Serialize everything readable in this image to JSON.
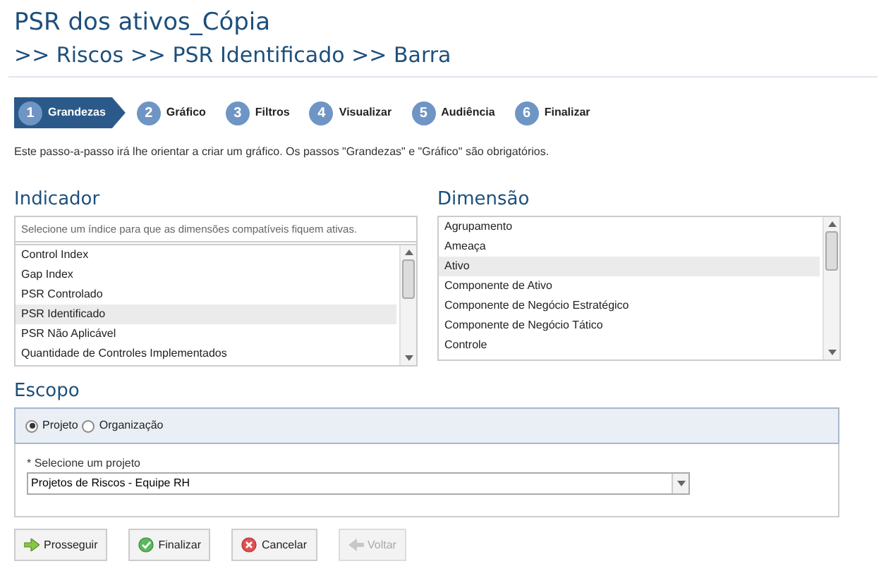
{
  "title": "PSR dos ativos_Cópia",
  "breadcrumb": ">> Riscos >> PSR Identificado >> Barra",
  "steps": [
    {
      "number": "1",
      "label": "Grandezas",
      "selected": true
    },
    {
      "number": "2",
      "label": "Gráfico",
      "selected": false
    },
    {
      "number": "3",
      "label": "Filtros",
      "selected": false
    },
    {
      "number": "4",
      "label": "Visualizar",
      "selected": false
    },
    {
      "number": "5",
      "label": "Audiência",
      "selected": false
    },
    {
      "number": "6",
      "label": "Finalizar",
      "selected": false
    }
  ],
  "intro": "Este passo-a-passo irá lhe orientar a criar um gráfico. Os passos \"Grandezas\" e \"Gráfico\" são obrigatórios.",
  "indicador": {
    "heading": "Indicador",
    "hint": "Selecione um índice para que as dimensões compatíveis fiquem ativas.",
    "items": [
      {
        "label": "Control Index",
        "selected": false
      },
      {
        "label": "Gap Index",
        "selected": false
      },
      {
        "label": "PSR Controlado",
        "selected": false
      },
      {
        "label": "PSR Identificado",
        "selected": true
      },
      {
        "label": "PSR Não Aplicável",
        "selected": false
      },
      {
        "label": "Quantidade de Controles Implementados",
        "selected": false
      }
    ]
  },
  "dimensao": {
    "heading": "Dimensão",
    "items": [
      {
        "label": "Agrupamento",
        "selected": false
      },
      {
        "label": "Ameaça",
        "selected": false
      },
      {
        "label": "Ativo",
        "selected": true
      },
      {
        "label": "Componente de Ativo",
        "selected": false
      },
      {
        "label": "Componente de Negócio Estratégico",
        "selected": false
      },
      {
        "label": "Componente de Negócio Tático",
        "selected": false
      },
      {
        "label": "Controle",
        "selected": false
      }
    ]
  },
  "escopo": {
    "heading": "Escopo",
    "options": [
      {
        "label": "Projeto",
        "selected": true
      },
      {
        "label": "Organização",
        "selected": false
      }
    ],
    "project_label": "* Selecione um projeto",
    "project_value": "Projetos de Riscos - Equipe RH"
  },
  "buttons": [
    {
      "label": "Prosseguir",
      "kind": "next",
      "disabled": false
    },
    {
      "label": "Finalizar",
      "kind": "finish",
      "disabled": false
    },
    {
      "label": "Cancelar",
      "kind": "cancel",
      "disabled": false
    },
    {
      "label": "Voltar",
      "kind": "back",
      "disabled": true
    }
  ]
}
